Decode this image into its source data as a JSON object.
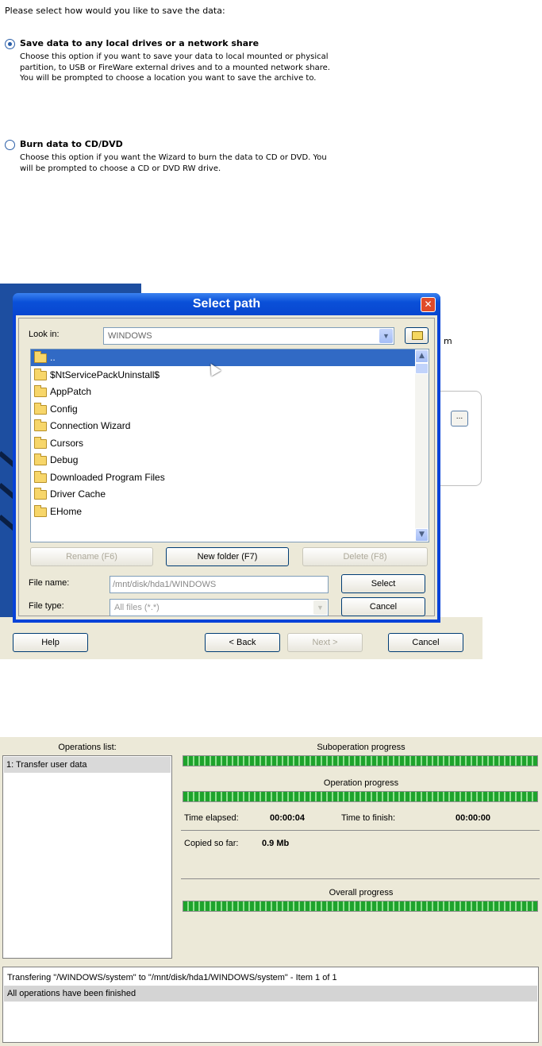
{
  "save_options": {
    "prompt": "Please select how would you like to save the data:",
    "options": [
      {
        "label": "Save data to any local drives or a network share",
        "selected": true,
        "description": "Choose this option if you want to save your data to local mounted or physical partition, to USB or FireWare external drives and to a mounted network share. You will be prompted to choose a location you want to save the archive to."
      },
      {
        "label": "Burn data to CD/DVD",
        "selected": false,
        "description": "Choose this option if you want the Wizard to burn the data to CD or DVD. You will be prompted to choose a CD or DVD RW drive."
      }
    ]
  },
  "background_wizard": {
    "partial_text": "m",
    "browse_label": "...",
    "buttons": {
      "help": "Help",
      "back": "< Back",
      "next": "Next >",
      "cancel": "Cancel"
    }
  },
  "select_path_dialog": {
    "title": "Select path",
    "close_label": "✕",
    "look_in_label": "Look in:",
    "look_in_value": "WINDOWS",
    "items": [
      "..",
      "$NtServicePackUninstall$",
      "AppPatch",
      "Config",
      "Connection Wizard",
      "Cursors",
      "Debug",
      "Downloaded Program Files",
      "Driver Cache",
      "EHome"
    ],
    "buttons": {
      "rename": "Rename (F6)",
      "new_folder": "New folder (F7)",
      "delete": "Delete (F8)",
      "select": "Select",
      "cancel": "Cancel"
    },
    "file_name_label": "File name:",
    "file_name_value": "/mnt/disk/hda1/WINDOWS",
    "file_type_label": "File type:",
    "file_type_value": "All files (*.*)"
  },
  "progress": {
    "operations_header": "Operations list:",
    "operations": [
      "1: Transfer user data"
    ],
    "suboperation_title": "Suboperation progress",
    "suboperation_value": 100,
    "operation_title": "Operation progress",
    "operation_value": 100,
    "time_elapsed_label": "Time elapsed:",
    "time_elapsed_value": "00:00:04",
    "time_to_finish_label": "Time to finish:",
    "time_to_finish_value": "00:00:00",
    "copied_label": "Copied so far:",
    "copied_value": "0.9 Mb",
    "overall_title": "Overall progress",
    "overall_value": 100,
    "log": [
      "Transfering \"/WINDOWS/system\" to \"/mnt/disk/hda1/WINDOWS/system\" - Item 1 of 1",
      "All operations have been finished"
    ],
    "colors": {
      "bar_fill": "#1ea32c",
      "bar_stripe": "#8fe08f"
    }
  }
}
